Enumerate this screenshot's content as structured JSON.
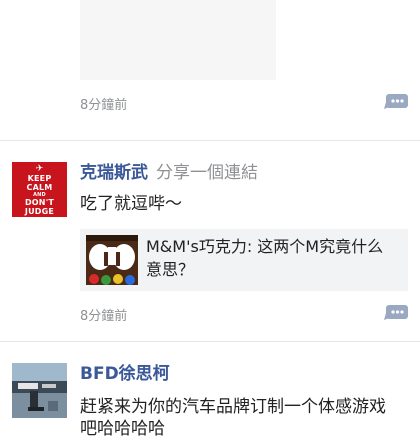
{
  "colors": {
    "author_name": "#3b5998",
    "meta_gray": "#8f9194",
    "body_text": "#222222",
    "link_card_bg": "#f2f3f5",
    "comment_icon": "#9aa8c1",
    "avatar_red": "#c8141d"
  },
  "feed": {
    "posts": [
      {
        "time": "8分鐘前",
        "comment_icon": "comment-bubble-icon"
      },
      {
        "author": "克瑞斯武",
        "action": "分享一個連結",
        "text": "吃了就逗哔～",
        "avatar": {
          "lines": [
            "KEEP",
            "CALM",
            "AND",
            "DON'T",
            "JUDGE"
          ]
        },
        "link": {
          "title": "M&M's巧克力: 这两个M究竟什么意思？"
        },
        "time": "8分鐘前",
        "comment_icon": "comment-bubble-icon"
      },
      {
        "author": "BFD徐思柯",
        "text": "赶紧来为你的汽车品牌订制一个体感游戏吧哈哈哈哈"
      }
    ]
  }
}
